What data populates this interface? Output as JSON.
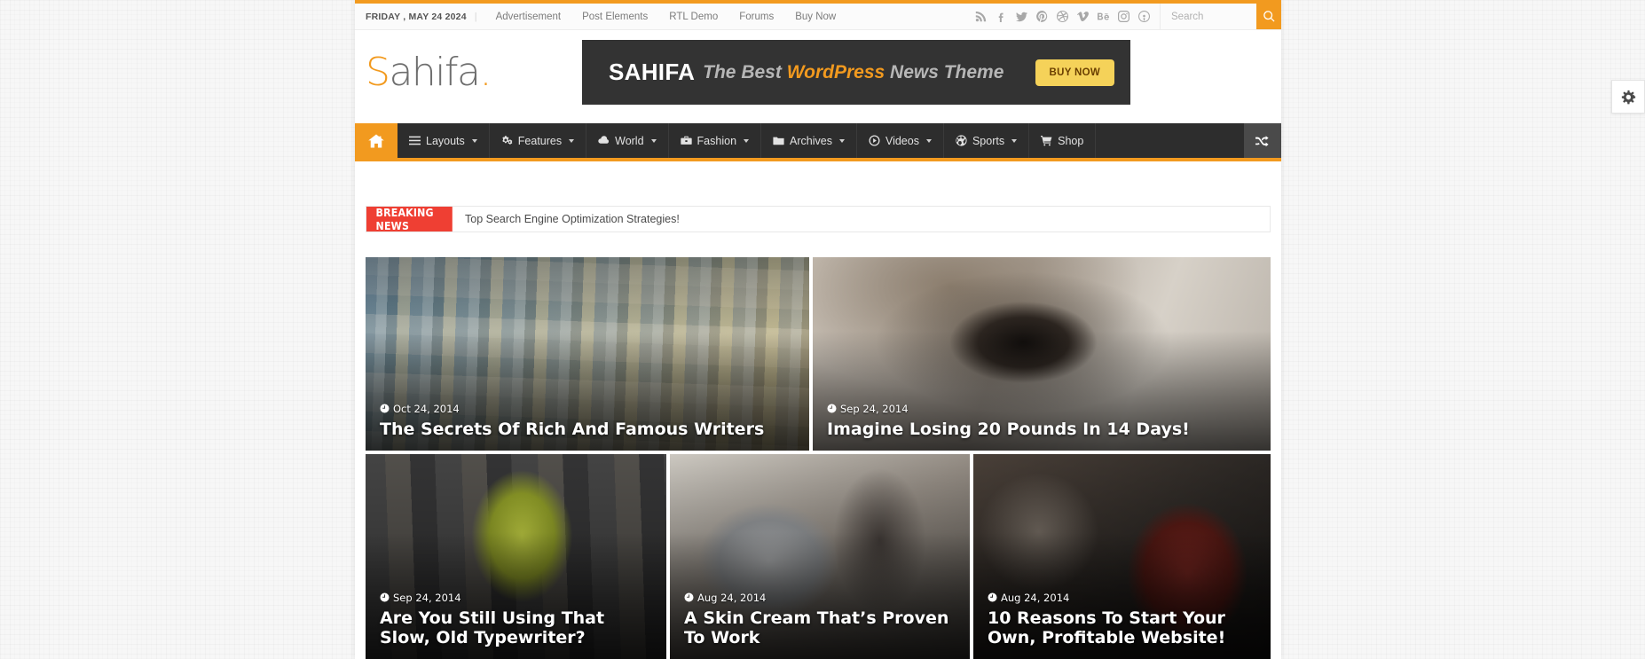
{
  "theme": {
    "accent": "#F29A1F",
    "dark": "#2d2d2d",
    "breaking_red": "#ef3f33",
    "banner_bg": "#333333",
    "buy_btn": "#F5D259"
  },
  "topbar": {
    "date": "FRIDAY , MAY 24 2024",
    "separator": "|",
    "links": [
      {
        "label": "Advertisement"
      },
      {
        "label": "Post Elements"
      },
      {
        "label": "RTL Demo"
      },
      {
        "label": "Forums"
      },
      {
        "label": "Buy Now"
      }
    ],
    "social": [
      {
        "name": "rss-icon"
      },
      {
        "name": "facebook-icon"
      },
      {
        "name": "twitter-icon"
      },
      {
        "name": "pinterest-icon"
      },
      {
        "name": "dribbble-icon"
      },
      {
        "name": "vimeo-icon"
      },
      {
        "name": "behance-icon"
      },
      {
        "name": "instagram-icon"
      },
      {
        "name": "podcast-icon"
      }
    ],
    "search": {
      "placeholder": "Search",
      "value": "",
      "button_icon": "search-icon"
    }
  },
  "header": {
    "logo": {
      "first": "S",
      "middle": "ahifa",
      "dot": "."
    },
    "banner": {
      "brand": "SAHIFA",
      "tagline_pre": "The Best ",
      "tagline_highlight": "WordPress",
      "tagline_post": " News Theme",
      "button": "BUY NOW"
    }
  },
  "menu": {
    "home_icon": "home-icon",
    "items": [
      {
        "label": "Layouts",
        "icon": "list-icon",
        "has_dropdown": true
      },
      {
        "label": "Features",
        "icon": "gears-icon",
        "has_dropdown": true
      },
      {
        "label": "World",
        "icon": "cloud-icon",
        "has_dropdown": true
      },
      {
        "label": "Fashion",
        "icon": "briefcase-icon",
        "has_dropdown": true
      },
      {
        "label": "Archives",
        "icon": "folder-icon",
        "has_dropdown": true
      },
      {
        "label": "Videos",
        "icon": "play-circle-icon",
        "has_dropdown": true
      },
      {
        "label": "Sports",
        "icon": "soccer-ball-icon",
        "has_dropdown": true
      },
      {
        "label": "Shop",
        "icon": "cart-icon",
        "has_dropdown": false
      }
    ],
    "random_icon": "shuffle-icon"
  },
  "breaking": {
    "label": "BREAKING NEWS",
    "headline": "Top Search Engine Optimization Strategies!"
  },
  "featured": [
    {
      "date": "Oct 24, 2014",
      "title": "The Secrets Of Rich And Famous Writers",
      "photo": "photo-city"
    },
    {
      "date": "Sep 24, 2014",
      "title": "Imagine Losing 20 Pounds In 14 Days!",
      "photo": "photo-eye"
    },
    {
      "date": "Sep 24, 2014",
      "title": "Are You Still Using That Slow, Old Typewriter?",
      "photo": "photo-street"
    },
    {
      "date": "Aug 24, 2014",
      "title": "A Skin Cream That’s Proven To Work",
      "photo": "photo-office"
    },
    {
      "date": "Aug 24, 2014",
      "title": "10 Reasons To Start Your Own, Profitable Website!",
      "photo": "photo-meeting"
    }
  ],
  "side_panel": {
    "icon": "gear-icon"
  }
}
